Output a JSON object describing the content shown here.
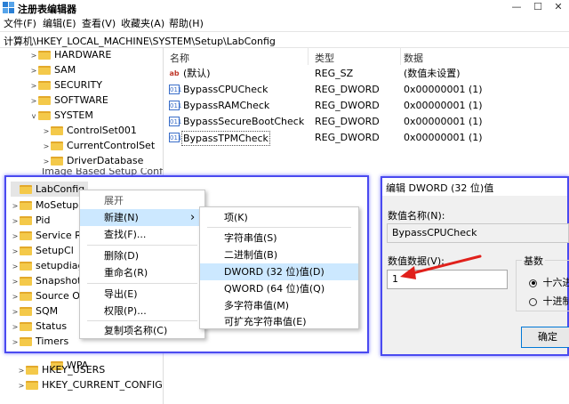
{
  "window": {
    "title": "注册表编辑器",
    "min": "—",
    "max": "☐",
    "close": "✕"
  },
  "menu": [
    "文件(F)",
    "编辑(E)",
    "查看(V)",
    "收藏夹(A)",
    "帮助(H)"
  ],
  "address": "计算机\\HKEY_LOCAL_MACHINE\\SYSTEM\\Setup\\LabConfig",
  "tree": {
    "top_items": [
      "HARDWARE",
      "SAM",
      "SECURITY",
      "SOFTWARE",
      "SYSTEM"
    ],
    "system_children": [
      "ControlSet001",
      "CurrentControlSet",
      "DriverDatabase"
    ],
    "partial_item": "Image Based Setup Config",
    "setup_children": [
      "LabConfig",
      "MoSetup",
      "Pid",
      "Service Re",
      "SetupCl",
      "setupdiag",
      "Snapshot",
      "Source OS",
      "SQM",
      "Status",
      "Timers"
    ],
    "wpa": "WPA",
    "hkeys": [
      "HKEY_USERS",
      "HKEY_CURRENT_CONFIG"
    ]
  },
  "list": {
    "headers": {
      "name": "名称",
      "type": "类型",
      "data": "数据"
    },
    "rows": [
      {
        "icon": "ab",
        "name": "(默认)",
        "type": "REG_SZ",
        "data": "(数值未设置)"
      },
      {
        "icon": "011",
        "name": "BypassCPUCheck",
        "type": "REG_DWORD",
        "data": "0x00000001 (1)"
      },
      {
        "icon": "011",
        "name": "BypassRAMCheck",
        "type": "REG_DWORD",
        "data": "0x00000001 (1)"
      },
      {
        "icon": "011",
        "name": "BypassSecureBootCheck",
        "type": "REG_DWORD",
        "data": "0x00000001 (1)"
      },
      {
        "icon": "011",
        "name": "BypassTPMCheck",
        "type": "REG_DWORD",
        "data": "0x00000001 (1)"
      }
    ]
  },
  "context_menu": {
    "items": [
      "展开",
      "新建(N)",
      "查找(F)...",
      "删除(D)",
      "重命名(R)",
      "导出(E)",
      "权限(P)...",
      "复制项名称(C)"
    ],
    "arrow": "›"
  },
  "submenu": {
    "items": [
      "项(K)",
      "字符串值(S)",
      "二进制值(B)",
      "DWORD (32 位)值(D)",
      "QWORD (64 位)值(Q)",
      "多字符串值(M)",
      "可扩充字符串值(E)"
    ]
  },
  "dialog": {
    "title": "编辑 DWORD (32 位)值",
    "name_label": "数值名称(N):",
    "name_value": "BypassCPUCheck",
    "data_label": "数值数据(V):",
    "data_value": "1",
    "base_label": "基数",
    "radio_hex": "十六进制",
    "radio_dec": "十进制",
    "ok": "确定"
  },
  "colors": {
    "highlight": "#4a4af0",
    "selection": "#cce8ff",
    "arrow": "#e0201b"
  }
}
